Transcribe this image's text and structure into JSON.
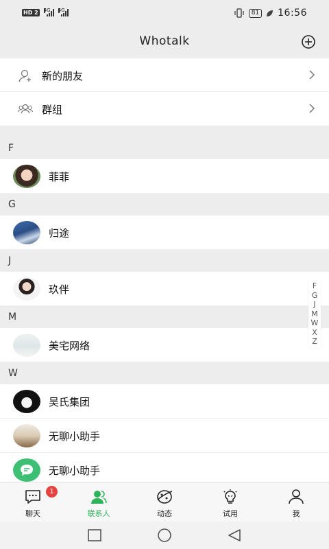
{
  "status": {
    "left_badge": "HD",
    "left_badge_num": "2",
    "net1": "4G",
    "net2": "4G",
    "battery": "81",
    "time": "16:56"
  },
  "header": {
    "title": "Whotalk"
  },
  "menu": [
    {
      "label": "新的朋友",
      "icon": "new-friend-icon"
    },
    {
      "label": "群组",
      "icon": "group-icon"
    }
  ],
  "sections": [
    {
      "letter": "F",
      "contacts": [
        {
          "name": "菲菲"
        }
      ]
    },
    {
      "letter": "G",
      "contacts": [
        {
          "name": "归途"
        }
      ]
    },
    {
      "letter": "J",
      "contacts": [
        {
          "name": "玖伴"
        }
      ]
    },
    {
      "letter": "M",
      "contacts": [
        {
          "name": "美宅网络"
        }
      ]
    },
    {
      "letter": "W",
      "contacts": [
        {
          "name": "吴氏集团"
        },
        {
          "name": "无聊小助手"
        },
        {
          "name": "无聊小助手"
        }
      ]
    }
  ],
  "index_letters": [
    "F",
    "G",
    "J",
    "M",
    "W",
    "X",
    "Z"
  ],
  "tabs": [
    {
      "label": "聊天",
      "icon": "chat-icon",
      "badge": "1"
    },
    {
      "label": "联系人",
      "icon": "contacts-icon",
      "active": true
    },
    {
      "label": "动态",
      "icon": "moments-icon"
    },
    {
      "label": "试用",
      "icon": "trial-icon"
    },
    {
      "label": "我",
      "icon": "me-icon"
    }
  ],
  "colors": {
    "accent": "#2eb35a",
    "badge": "#e64340",
    "background": "#ededed"
  }
}
